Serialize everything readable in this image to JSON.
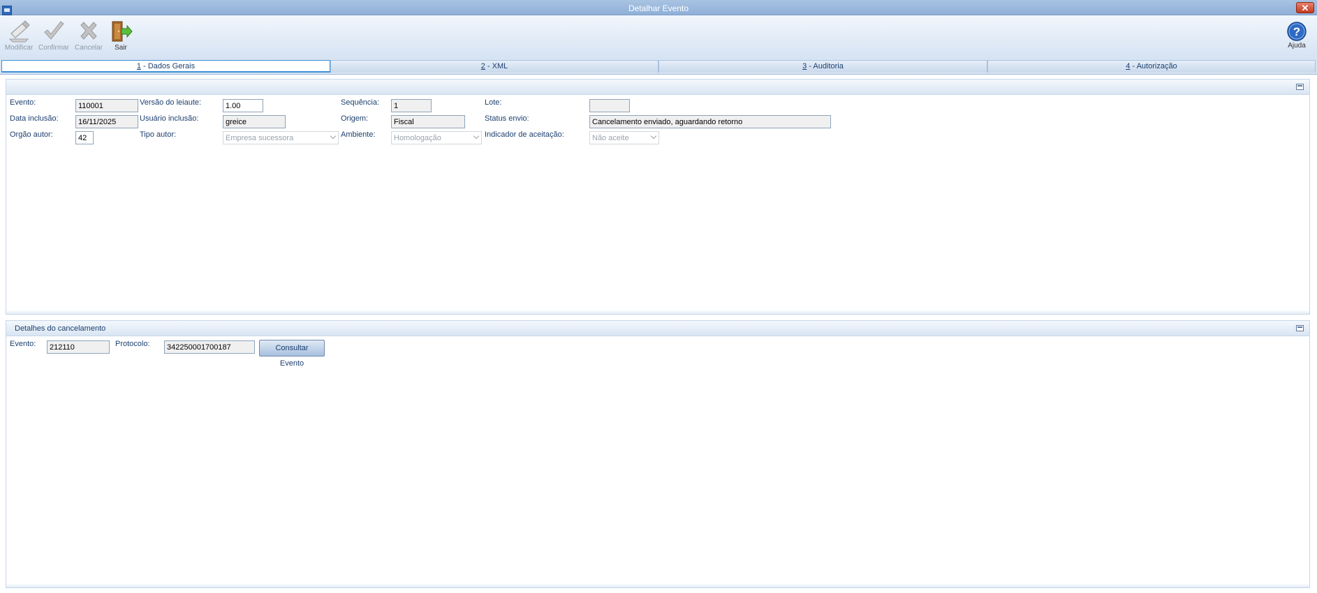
{
  "window": {
    "title": "Detalhar Evento",
    "close_label": "✕"
  },
  "toolbar": {
    "modify": {
      "label": "Modificar",
      "icon": "edit-icon"
    },
    "confirm": {
      "label": "Confirmar",
      "icon": "checkmark-icon"
    },
    "cancel": {
      "label": "Cancelar",
      "icon": "x-icon"
    },
    "exit": {
      "label": "Sair",
      "icon": "door-exit-icon"
    },
    "help": {
      "label": "Ajuda",
      "icon": "help-icon"
    }
  },
  "tabs": [
    {
      "key": "1",
      "label": " - Dados Gerais"
    },
    {
      "key": "2",
      "label": " - XML"
    },
    {
      "key": "3",
      "label": " - Auditoria"
    },
    {
      "key": "4",
      "label": " - Autorização"
    }
  ],
  "general": {
    "evento": {
      "label": "Evento:",
      "value": "110001"
    },
    "versao": {
      "label": "Versão do leiaute:",
      "value": "1.00"
    },
    "sequencia": {
      "label": "Sequência:",
      "value": "1"
    },
    "lote": {
      "label": "Lote:",
      "value": ""
    },
    "data_inclusao": {
      "label": "Data inclusão:",
      "value": "16/11/2025"
    },
    "usuario_inclusao": {
      "label": "Usuário inclusão:",
      "value": "greice"
    },
    "origem": {
      "label": "Origem:",
      "value": "Fiscal"
    },
    "status_envio": {
      "label": "Status envio:",
      "value": "Cancelamento enviado, aguardando retorno"
    },
    "orgao_autor": {
      "label": "Orgão autor:",
      "value": "42"
    },
    "tipo_autor": {
      "label": "Tipo autor:",
      "value": "Empresa sucessora"
    },
    "ambiente": {
      "label": "Ambiente:",
      "value": "Homologação"
    },
    "indicador": {
      "label": "Indicador de aceitação:",
      "value": "Não aceite"
    }
  },
  "cancel_details": {
    "title": "Detalhes do cancelamento",
    "evento": {
      "label": "Evento:",
      "value": "212110"
    },
    "protocolo": {
      "label": "Protocolo:",
      "value": "342250001700187"
    },
    "consult_button": "Consultar Evento"
  }
}
